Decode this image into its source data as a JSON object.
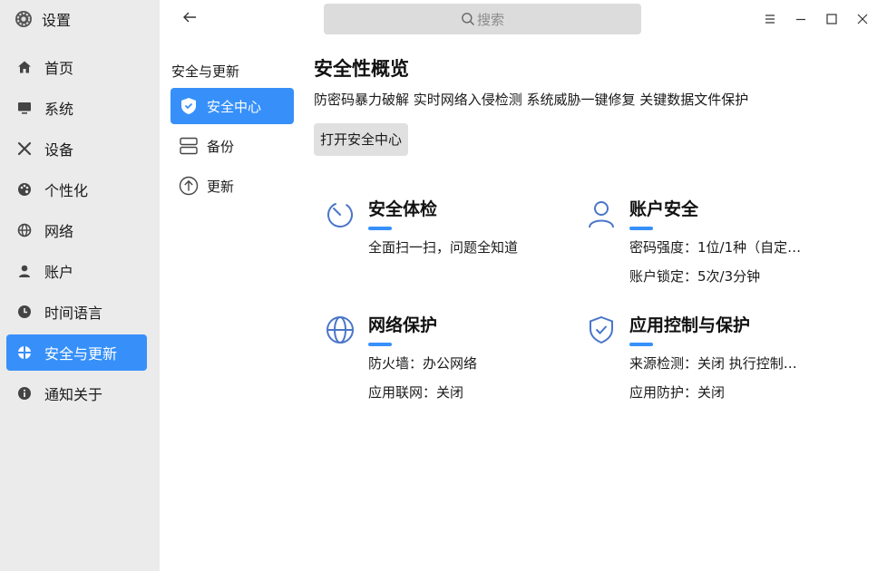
{
  "app": {
    "title": "设置",
    "icon": "gear-icon"
  },
  "sidebar": {
    "items": [
      {
        "label": "首页",
        "icon": "home-icon"
      },
      {
        "label": "系统",
        "icon": "monitor-icon"
      },
      {
        "label": "设备",
        "icon": "tools-icon"
      },
      {
        "label": "个性化",
        "icon": "palette-icon"
      },
      {
        "label": "网络",
        "icon": "globe-icon"
      },
      {
        "label": "账户",
        "icon": "user-icon"
      },
      {
        "label": "时间语言",
        "icon": "clock-icon"
      },
      {
        "label": "安全与更新",
        "icon": "shield-icon",
        "active": true
      },
      {
        "label": "通知关于",
        "icon": "info-icon"
      }
    ]
  },
  "subnav": {
    "title": "安全与更新",
    "items": [
      {
        "label": "安全中心",
        "icon": "shield-check-icon",
        "active": true
      },
      {
        "label": "备份",
        "icon": "backup-icon"
      },
      {
        "label": "更新",
        "icon": "update-icon"
      }
    ]
  },
  "search": {
    "placeholder": "搜索"
  },
  "main": {
    "title": "安全性概览",
    "description": "防密码暴力破解 实时网络入侵检测 系统威胁一键修复 关键数据文件保护",
    "open_button": "打开安全中心",
    "cards": [
      {
        "title": "安全体检",
        "icon": "scan-icon",
        "lines": [
          "全面扫一扫，问题全知道"
        ]
      },
      {
        "title": "账户安全",
        "icon": "account-icon",
        "lines": [
          "密码强度：1位/1种（自定…",
          "账户锁定：5次/3分钟"
        ]
      },
      {
        "title": "网络保护",
        "icon": "network-globe-icon",
        "lines": [
          "防火墙：办公网络",
          "应用联网：关闭"
        ]
      },
      {
        "title": "应用控制与保护",
        "icon": "app-shield-icon",
        "lines": [
          "来源检测：关闭    执行控制…",
          "应用防护：关闭"
        ]
      }
    ]
  },
  "colors": {
    "accent": "#3790fa",
    "sidebar_bg": "#ebebeb",
    "icon_blue": "#4a76c9"
  }
}
